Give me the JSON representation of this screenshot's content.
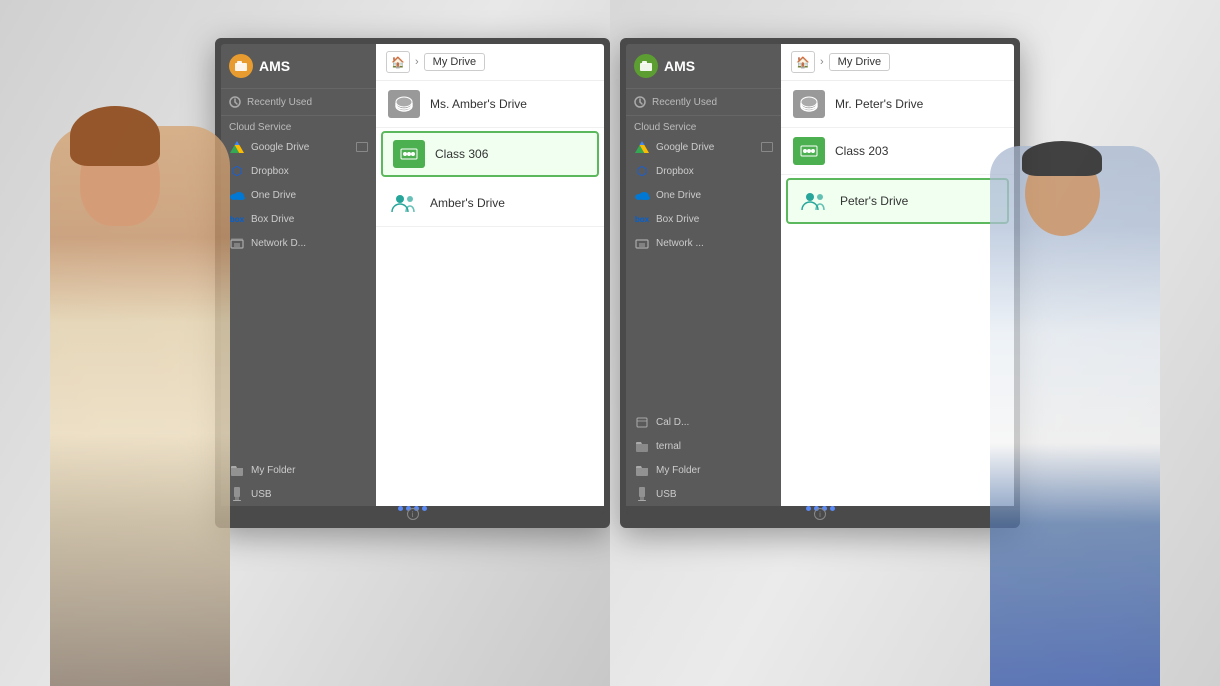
{
  "left_panel": {
    "monitor": {
      "ams_icon_color": "#e89c30",
      "title": "AMS",
      "recently_used": "Recently Used",
      "cloud_service": "Cloud Service",
      "items": [
        {
          "name": "Google Drive",
          "type": "gdrive",
          "linked": true
        },
        {
          "name": "Dropbox",
          "type": "dropbox",
          "linked": false
        },
        {
          "name": "One Drive",
          "type": "onedrive",
          "linked": false
        },
        {
          "name": "Box Drive",
          "type": "box",
          "linked": false
        },
        {
          "name": "Network D...",
          "type": "network",
          "linked": false
        }
      ],
      "breadcrumb_home": "🏠",
      "breadcrumb_label": "My Drive",
      "files": [
        {
          "name": "Ms. Amber's Drive",
          "type": "drive",
          "selected": false
        },
        {
          "name": "Class 306",
          "type": "class",
          "selected": true
        },
        {
          "name": "Amber's Drive",
          "type": "people",
          "selected": false
        }
      ],
      "bottom_items": [
        {
          "name": "My Folder",
          "type": "folder"
        },
        {
          "name": "USB",
          "type": "usb"
        }
      ],
      "dots": [
        "#5a8af5",
        "#5a8af5",
        "#5a8af5",
        "#5a8af5"
      ]
    }
  },
  "right_panel": {
    "monitor": {
      "ams_icon_color": "#5c9e31",
      "title": "AMS",
      "recently_used": "Recently Used",
      "cloud_service": "Cloud Service",
      "items": [
        {
          "name": "Google Drive",
          "type": "gdrive",
          "linked": true
        },
        {
          "name": "Dropbox",
          "type": "dropbox",
          "linked": false
        },
        {
          "name": "One Drive",
          "type": "onedrive",
          "linked": false
        },
        {
          "name": "Box Drive",
          "type": "box",
          "linked": false
        },
        {
          "name": "Network ...",
          "type": "network",
          "linked": false
        }
      ],
      "breadcrumb_home": "🏠",
      "breadcrumb_label": "My Drive",
      "files": [
        {
          "name": "Mr. Peter's Drive",
          "type": "drive",
          "selected": false
        },
        {
          "name": "Class 203",
          "type": "class",
          "selected": false
        },
        {
          "name": "Peter's Drive",
          "type": "people",
          "selected": true
        }
      ],
      "bottom_items": [
        {
          "name": "Cal D...",
          "type": "folder"
        },
        {
          "name": "ternal",
          "type": "folder"
        },
        {
          "name": "My Folder",
          "type": "folder"
        },
        {
          "name": "USB",
          "type": "usb"
        }
      ],
      "dots": [
        "#5a8af5",
        "#5a8af5",
        "#5a8af5",
        "#5a8af5"
      ]
    }
  }
}
